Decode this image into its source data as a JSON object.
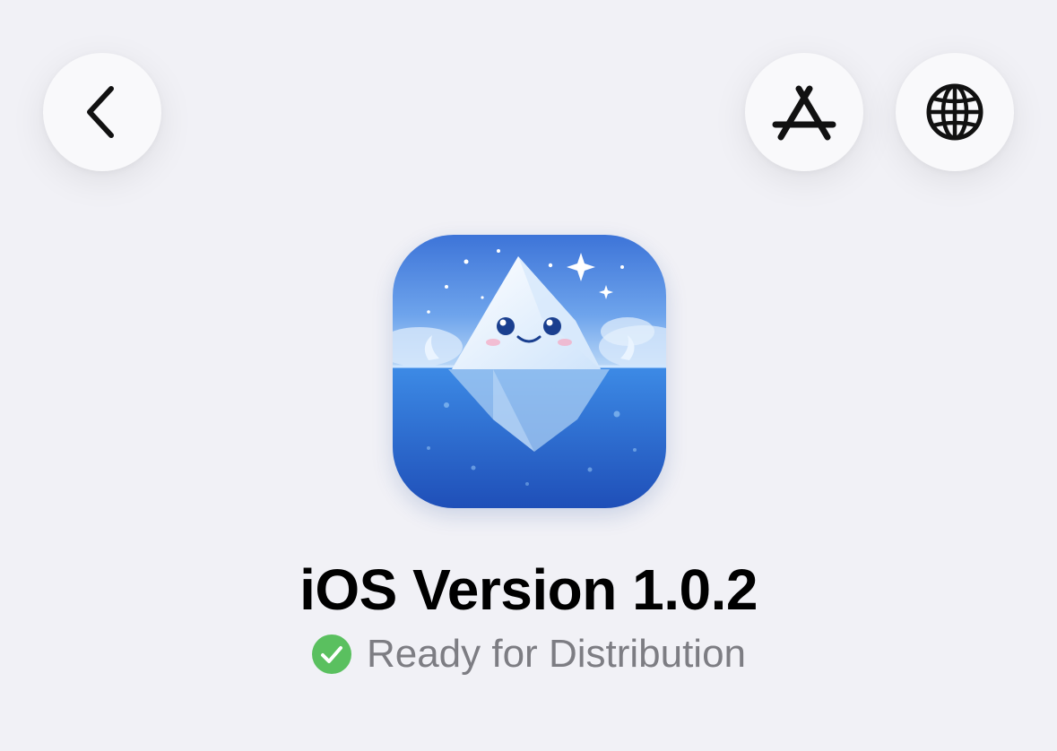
{
  "nav": {
    "back_icon": "chevron-left-icon",
    "app_store_icon": "app-store-icon",
    "web_icon": "globe-icon"
  },
  "app": {
    "icon_name": "iceberg-app-icon"
  },
  "version": {
    "title": "iOS Version 1.0.2",
    "status_icon": "checkmark-circle-icon",
    "status_text": "Ready for Distribution",
    "status_color": "#5ac05f"
  },
  "colors": {
    "background": "#f1f1f6",
    "button_bg": "#f9f9fb",
    "title": "#000000",
    "status_text": "#7d7d83"
  }
}
